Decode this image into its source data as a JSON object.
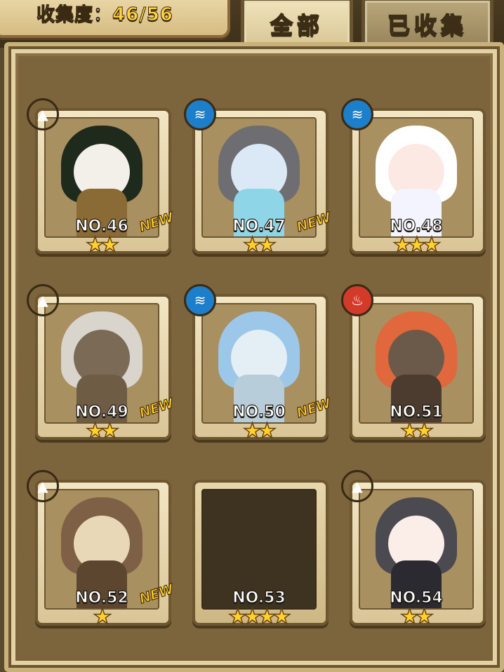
{
  "header": {
    "collection_label": "收集度：",
    "collection_value": "46/56",
    "tabs": [
      {
        "label": "全部",
        "active": true
      },
      {
        "label": "已收集",
        "active": false
      }
    ]
  },
  "cards": [
    {
      "number": "NO.46",
      "element": "earth",
      "stars": "★★",
      "new": "NEW",
      "colors": {
        "hair": "#1e2a1c",
        "skin": "#f3f0ea",
        "body": "#8a6a35"
      }
    },
    {
      "number": "NO.47",
      "element": "water",
      "stars": "★★",
      "new": "NEW",
      "colors": {
        "hair": "#6d6d72",
        "skin": "#dbe9f6",
        "body": "#8fd5e8"
      }
    },
    {
      "number": "NO.48",
      "element": "water",
      "stars": "★★★",
      "new": "",
      "colors": {
        "hair": "#ffffff",
        "skin": "#fde9e4",
        "body": "#f4f4ff"
      }
    },
    {
      "number": "NO.49",
      "element": "earth",
      "stars": "★★",
      "new": "NEW",
      "colors": {
        "hair": "#d9d4cc",
        "skin": "#7b6a55",
        "body": "#6e5c45"
      }
    },
    {
      "number": "NO.50",
      "element": "water",
      "stars": "★★",
      "new": "NEW",
      "colors": {
        "hair": "#9cc7e9",
        "skin": "#e4eef5",
        "body": "#b7cdd9"
      }
    },
    {
      "number": "NO.51",
      "element": "fire",
      "stars": "★★",
      "new": "",
      "colors": {
        "hair": "#e0683c",
        "skin": "#6b5a4a",
        "body": "#4c3c30"
      }
    },
    {
      "number": "NO.52",
      "element": "earth",
      "stars": "★",
      "new": "NEW",
      "colors": {
        "hair": "#7d6045",
        "skin": "#e8d8b8",
        "body": "#5c4630"
      }
    },
    {
      "number": "NO.53",
      "element": "",
      "stars": "★★★★",
      "new": "",
      "colors": {
        "hair": "",
        "skin": "",
        "body": ""
      }
    },
    {
      "number": "NO.54",
      "element": "earth",
      "stars": "★★",
      "new": "",
      "colors": {
        "hair": "#4a4a50",
        "skin": "#fbeee8",
        "body": "#2a2a30"
      }
    }
  ],
  "icons": {
    "earth": "mountain-icon",
    "water": "wave-icon",
    "fire": "flame-icon"
  }
}
